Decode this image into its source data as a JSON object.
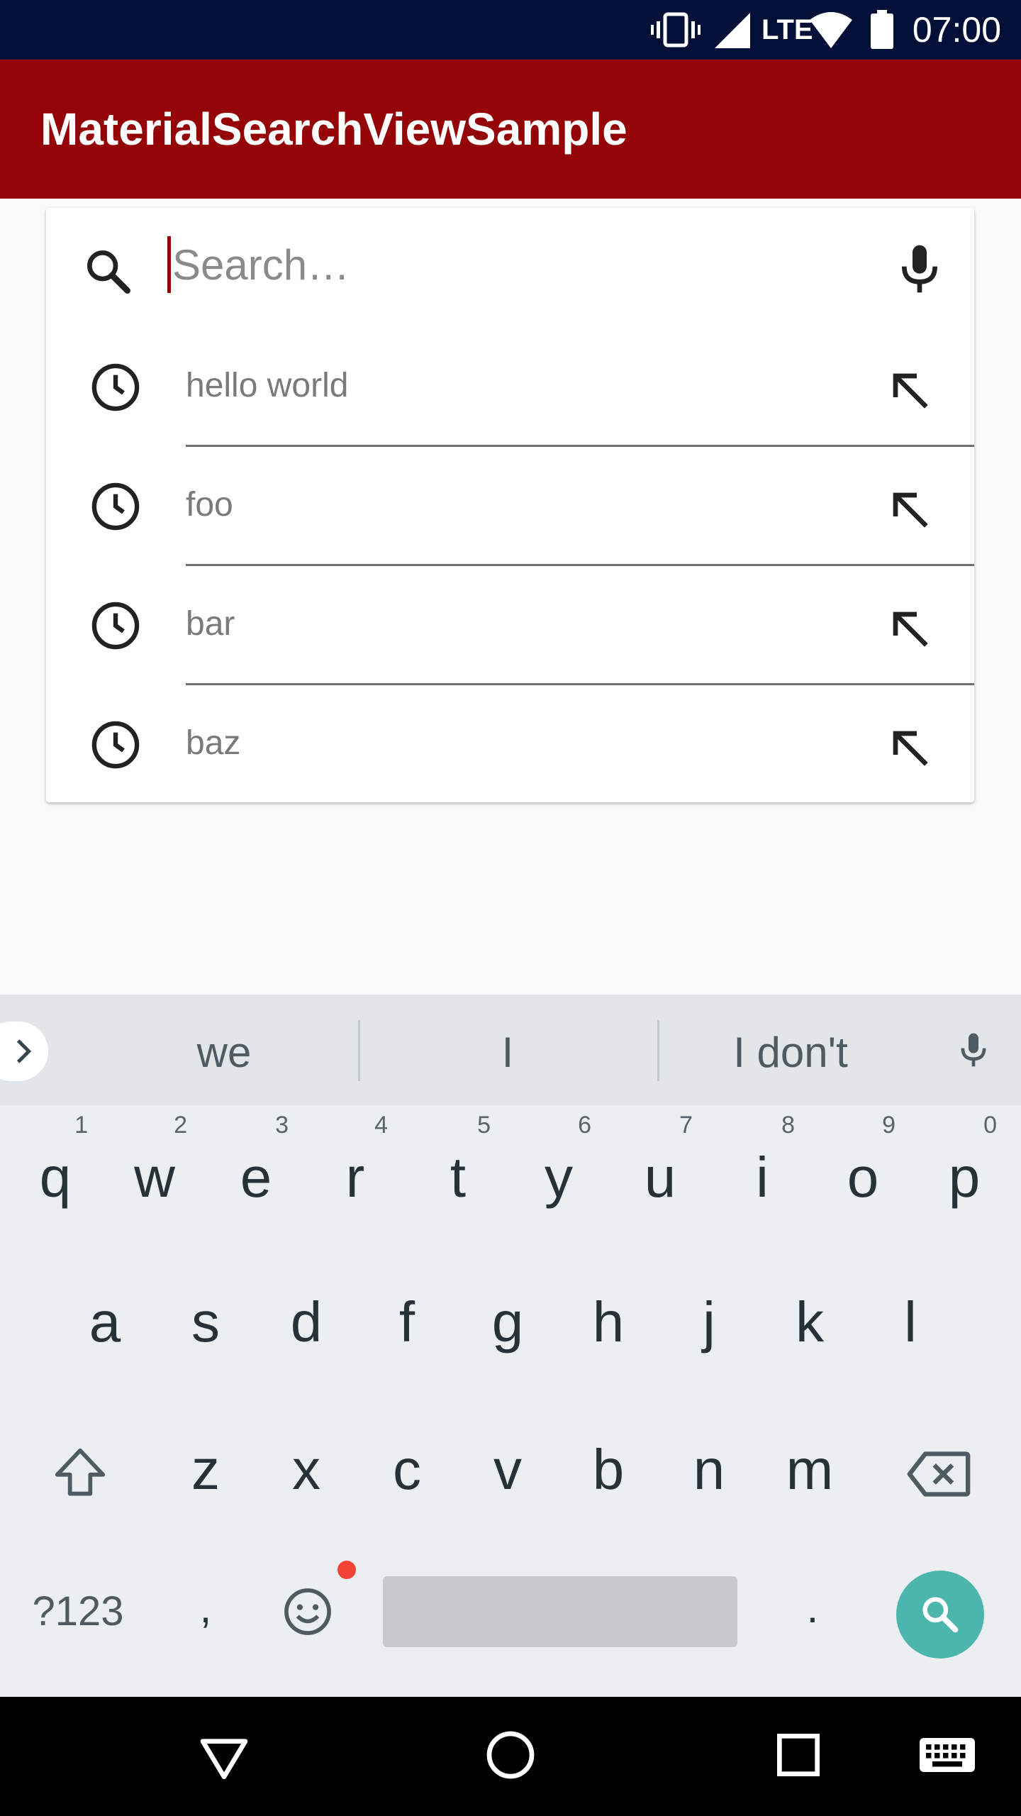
{
  "status_bar": {
    "time": "07:00",
    "network": "LTE",
    "icons": [
      "vibrate-icon",
      "signal-icon",
      "wifi-icon",
      "battery-icon"
    ]
  },
  "app_bar": {
    "title": "MaterialSearchViewSample",
    "color": "#940406"
  },
  "search": {
    "placeholder": "Search…",
    "value": "",
    "icons": [
      "search-icon",
      "mic-icon"
    ]
  },
  "suggestions": [
    {
      "label": "hello world",
      "icon": "history-clock-icon",
      "action_icon": "fill-arrow-icon"
    },
    {
      "label": "foo",
      "icon": "history-clock-icon",
      "action_icon": "fill-arrow-icon"
    },
    {
      "label": "bar",
      "icon": "history-clock-icon",
      "action_icon": "fill-arrow-icon"
    },
    {
      "label": "baz",
      "icon": "history-clock-icon",
      "action_icon": "fill-arrow-icon"
    }
  ],
  "keyboard": {
    "suggestion_strip": [
      "we",
      "I",
      "I don't"
    ],
    "row1": [
      {
        "key": "q",
        "hint": "1"
      },
      {
        "key": "w",
        "hint": "2"
      },
      {
        "key": "e",
        "hint": "3"
      },
      {
        "key": "r",
        "hint": "4"
      },
      {
        "key": "t",
        "hint": "5"
      },
      {
        "key": "y",
        "hint": "6"
      },
      {
        "key": "u",
        "hint": "7"
      },
      {
        "key": "i",
        "hint": "8"
      },
      {
        "key": "o",
        "hint": "9"
      },
      {
        "key": "p",
        "hint": "0"
      }
    ],
    "row2": [
      "a",
      "s",
      "d",
      "f",
      "g",
      "h",
      "j",
      "k",
      "l"
    ],
    "row3": [
      "z",
      "x",
      "c",
      "v",
      "b",
      "n",
      "m"
    ],
    "symbols_label": "?123",
    "comma": ",",
    "period": ".",
    "action_color": "#4db6ac"
  },
  "nav_bar": {
    "icons": [
      "back-icon",
      "home-icon",
      "recents-icon",
      "keyboard-switch-icon"
    ]
  }
}
